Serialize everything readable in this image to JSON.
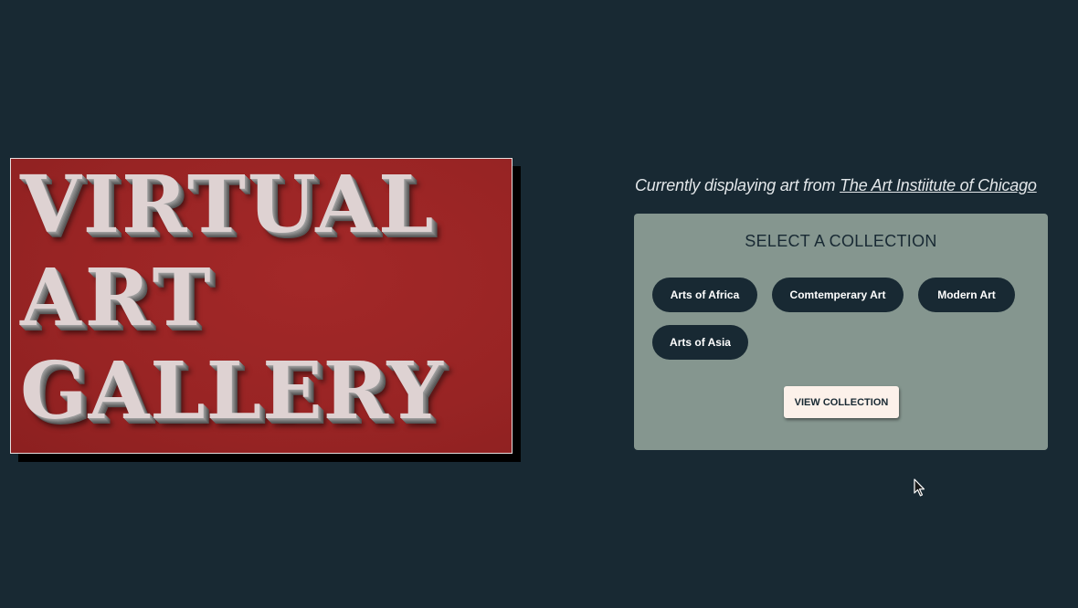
{
  "hero": {
    "line1": "VIRTUAL",
    "line2": "ART",
    "line3": "GALLERY",
    "background_color": "#a02626",
    "text_color": "#ded2d2"
  },
  "source": {
    "prefix": "Currently displaying art from ",
    "link_text": "The Art Instiitute of Chicago"
  },
  "panel": {
    "title": "SELECT A COLLECTION",
    "collections": [
      {
        "label": "Arts of Africa"
      },
      {
        "label": "Comtemperary Art"
      },
      {
        "label": "Modern Art"
      },
      {
        "label": "Arts of Asia"
      }
    ],
    "view_button_label": "VIEW COLLECTION"
  },
  "theme": {
    "page_background": "#182933",
    "panel_background": "#85968f",
    "pill_background": "#182933",
    "button_background": "#fcf1ea"
  },
  "cursor": {
    "icon": "mouse-pointer-icon"
  }
}
